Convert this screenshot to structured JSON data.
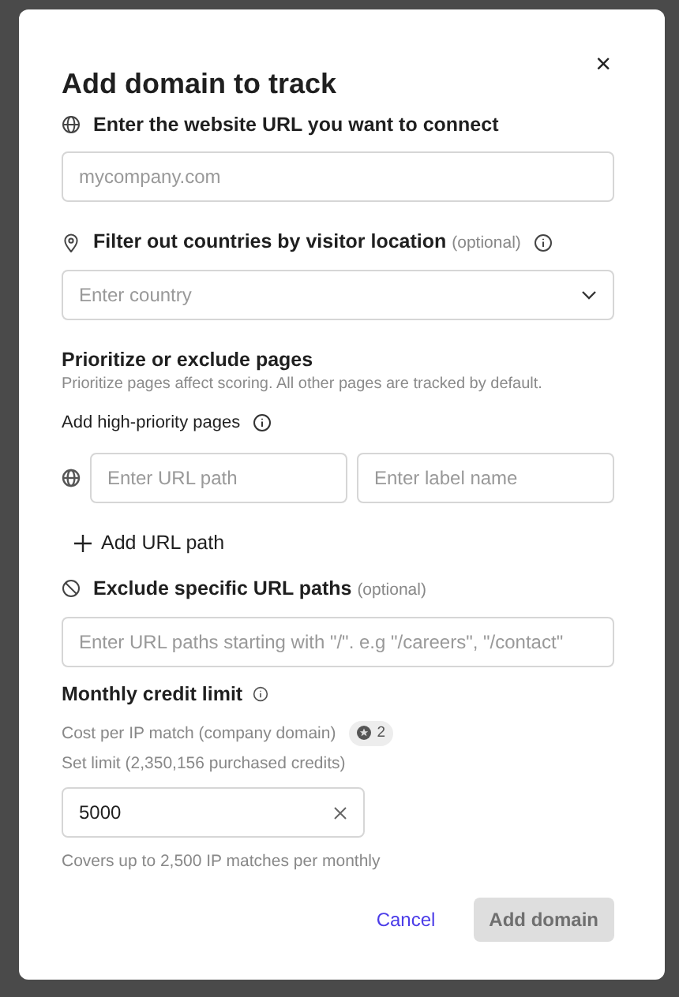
{
  "dialog": {
    "title": "Add domain to track",
    "close": "×"
  },
  "website": {
    "label": "Enter the website URL you want to connect",
    "placeholder": "mycompany.com"
  },
  "countries": {
    "label": "Filter out countries by visitor location",
    "optional": "(optional)",
    "placeholder": "Enter country"
  },
  "pages": {
    "heading": "Prioritize or exclude pages",
    "description": "Prioritize pages affect scoring. All other pages are tracked by default.",
    "priority_label": "Add high-priority pages",
    "url_placeholder": "Enter URL path",
    "label_placeholder": "Enter label name",
    "add_link": "Add URL path"
  },
  "exclude": {
    "label": "Exclude specific URL paths",
    "optional": "(optional)",
    "placeholder": "Enter URL paths starting with \"/\". e.g \"/careers\", \"/contact\""
  },
  "credit": {
    "heading": "Monthly credit limit",
    "cost_label": "Cost per IP match (company domain)",
    "cost_value": "2",
    "limit_label": "Set limit (2,350,156 purchased credits)",
    "value": "5000",
    "hint": "Covers up to 2,500 IP matches per monthly"
  },
  "buttons": [
    {
      "label": "Cancel",
      "kind": "link",
      "disabled": false
    },
    {
      "label": "Add domain",
      "kind": "primary",
      "disabled": true
    }
  ]
}
